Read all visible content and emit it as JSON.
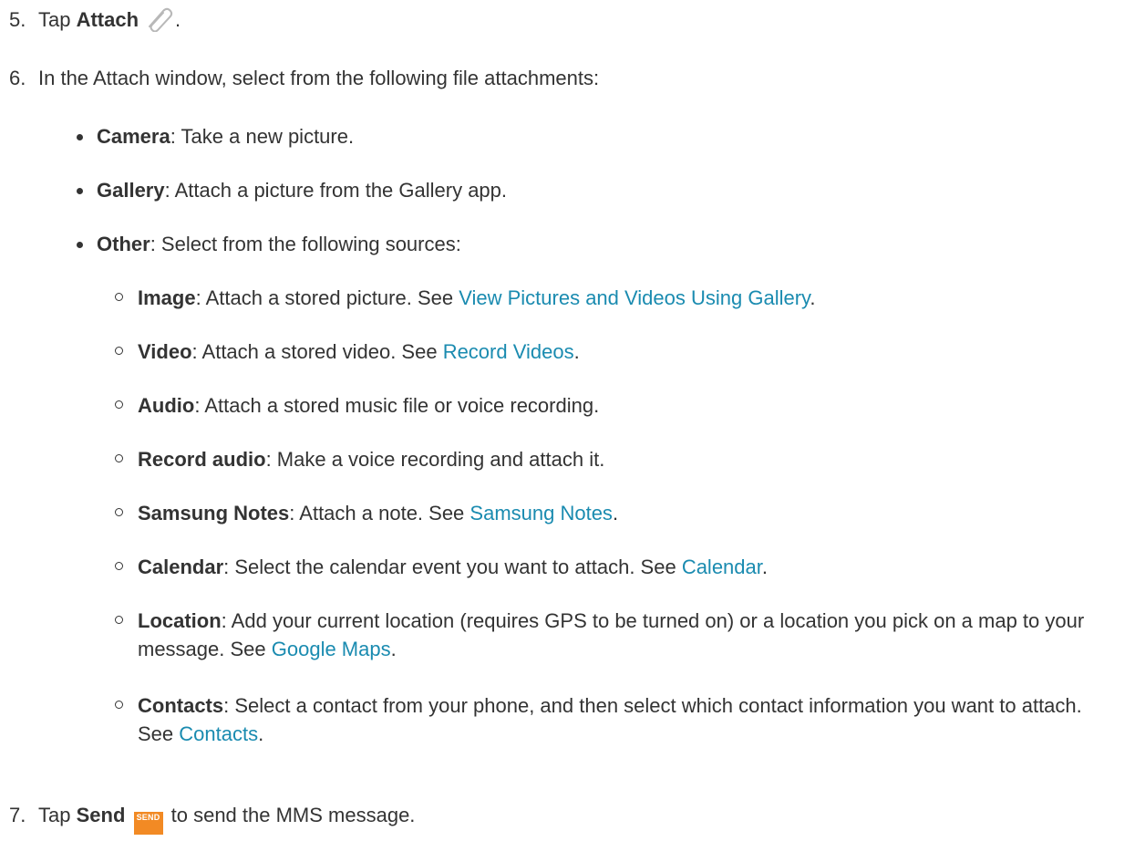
{
  "steps": {
    "s5": {
      "num": "5.",
      "prefix": "Tap ",
      "bold": "Attach",
      "suffix": ".",
      "icon": "paperclip-icon"
    },
    "s6": {
      "num": "6.",
      "text": "In the Attach window, select from the following file attachments:"
    },
    "s7": {
      "num": "7.",
      "prefix": "Tap ",
      "bold": "Send",
      "suffix": " to send the MMS message.",
      "icon": "send-button-icon",
      "icon_text": "SEND",
      "icon_color": "#f28a24"
    }
  },
  "attachments": [
    {
      "name": "Camera",
      "desc": ": Take a new picture."
    },
    {
      "name": "Gallery",
      "desc": ": Attach a picture from the Gallery app."
    },
    {
      "name": "Other",
      "desc": ": Select from the following sources:"
    }
  ],
  "sources": [
    {
      "name": "Image",
      "desc": ": Attach a stored picture. See ",
      "link": "View Pictures and Videos Using Gallery",
      "end": "."
    },
    {
      "name": "Video",
      "desc": ": Attach a stored video. See ",
      "link": "Record Videos",
      "end": "."
    },
    {
      "name": "Audio",
      "desc": ": Attach a stored music file or voice recording."
    },
    {
      "name": "Record audio",
      "desc": ": Make a voice recording and attach it."
    },
    {
      "name": "Samsung Notes",
      "desc": ": Attach a note. See ",
      "link": "Samsung Notes",
      "end": "."
    },
    {
      "name": "Calendar",
      "desc": ": Select the calendar event you want to attach. See ",
      "link": "Calendar",
      "end": "."
    },
    {
      "name": "Location",
      "desc": ": Add your current location (requires GPS to be turned on) or a location you pick on a map to your message. See ",
      "link": "Google Maps",
      "end": "."
    },
    {
      "name": "Contacts",
      "desc": ": Select a contact from your phone, and then select which contact information you want to attach. See ",
      "link": "Contacts",
      "end": "."
    }
  ],
  "colors": {
    "text": "#333333",
    "link": "#1a8bb0"
  }
}
